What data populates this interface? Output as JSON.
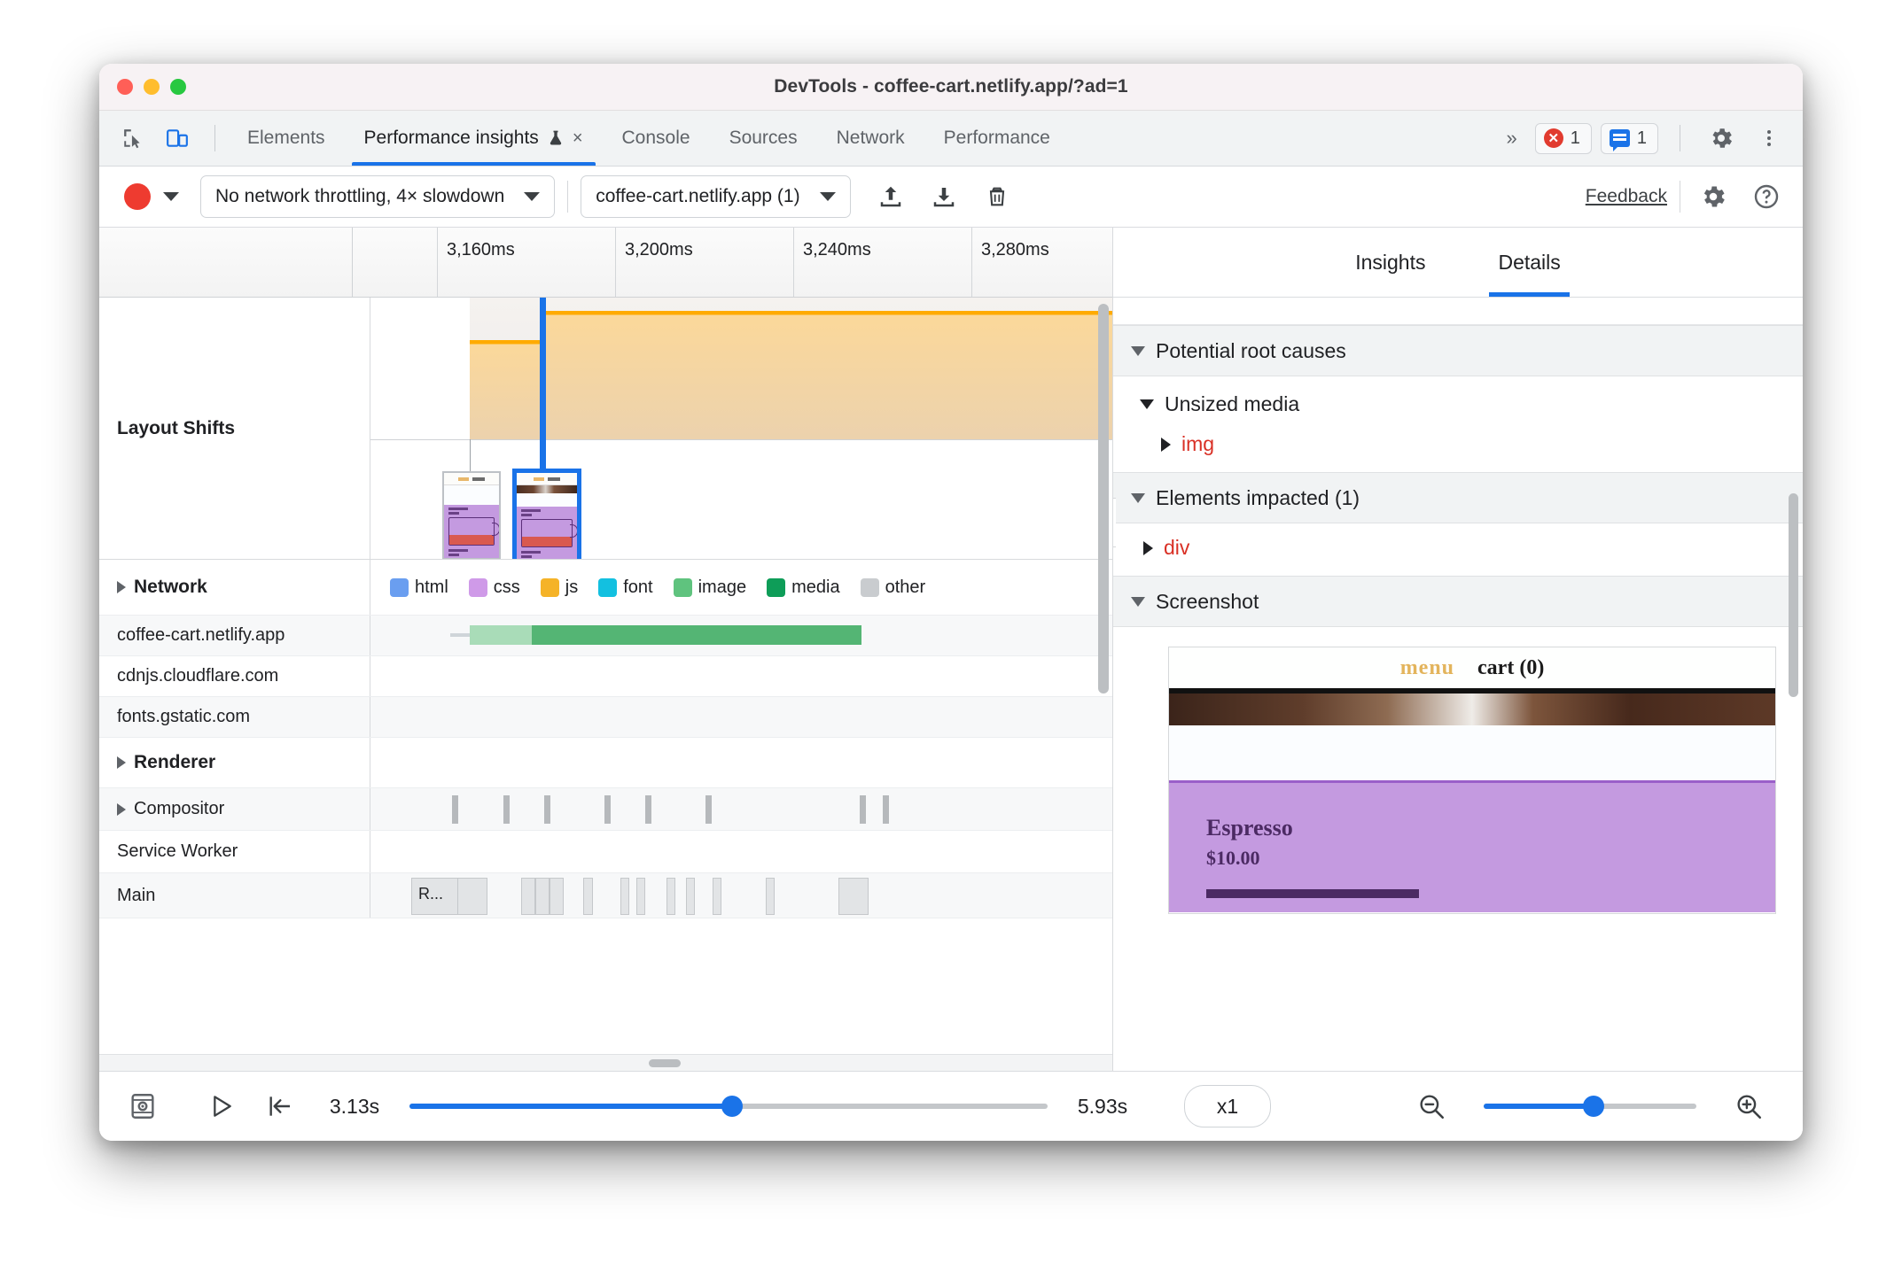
{
  "window": {
    "title": "DevTools - coffee-cart.netlify.app/?ad=1"
  },
  "tabbar": {
    "inspect_icon": "inspect-cursor-icon",
    "device_icon": "device-toolbar-icon",
    "tabs": [
      {
        "label": "Elements",
        "active": false
      },
      {
        "label": "Performance insights",
        "active": true,
        "beaker": "⚗",
        "close": "×"
      },
      {
        "label": "Console",
        "active": false
      },
      {
        "label": "Sources",
        "active": false
      },
      {
        "label": "Network",
        "active": false
      },
      {
        "label": "Performance",
        "active": false
      }
    ],
    "overflow": "»",
    "error_count": "1",
    "info_count": "1",
    "settings_icon": "gear-icon",
    "more_icon": "kebab-menu-icon"
  },
  "toolbar": {
    "record_icon": "record-button",
    "record_caret": "chevron-down-icon",
    "throttling": "No network throttling, 4× slowdown",
    "page_select": "coffee-cart.netlify.app (1)",
    "upload_icon": "upload-icon",
    "download_icon": "download-icon",
    "trash_icon": "trash-icon",
    "feedback": "Feedback",
    "settings_icon": "gear-icon",
    "help_icon": "help-icon"
  },
  "timeline": {
    "ticks": [
      "3,160ms",
      "3,200ms",
      "3,240ms",
      "3,280ms"
    ],
    "tracks": {
      "layout_shifts": "Layout Shifts",
      "network": "Network",
      "renderer": "Renderer",
      "compositor": "Compositor",
      "service_worker": "Service Worker",
      "main": "Main",
      "main_task_label": "R..."
    },
    "network_legend": [
      {
        "label": "html",
        "color": "#6a9ef0"
      },
      {
        "label": "css",
        "color": "#cf9ae8"
      },
      {
        "label": "js",
        "color": "#f5b328"
      },
      {
        "label": "font",
        "color": "#13c0e0"
      },
      {
        "label": "image",
        "color": "#5fc37e"
      },
      {
        "label": "media",
        "color": "#0e9d58"
      },
      {
        "label": "other",
        "color": "#c9cccf"
      }
    ],
    "network_rows": [
      "coffee-cart.netlify.app",
      "cdnjs.cloudflare.com",
      "fonts.gstatic.com"
    ]
  },
  "details_panel": {
    "tabs": [
      {
        "label": "Insights",
        "active": false
      },
      {
        "label": "Details",
        "active": true
      }
    ],
    "sections": [
      {
        "title": "Potential root causes",
        "expanded": true
      },
      {
        "title": "Elements impacted (1)",
        "expanded": true
      },
      {
        "title": "Screenshot",
        "expanded": true
      }
    ],
    "root_cause_group": "Unsized media",
    "root_cause_node": "img",
    "impacted_node": "div",
    "collapse_icon": "›",
    "screenshot": {
      "nav_menu": "menu",
      "nav_cart": "cart (0)",
      "product_title": "Espresso",
      "product_price": "$10.00"
    }
  },
  "bottombar": {
    "filmstrip_icon": "filmstrip-icon",
    "play_icon": "play-button",
    "jump_start_icon": "jump-to-start-icon",
    "start_time": "3.13s",
    "end_time": "5.93s",
    "speed": "x1",
    "zoom_out_icon": "zoom-out-icon",
    "zoom_in_icon": "zoom-in-icon"
  },
  "colors": {
    "accent": "#1a73e8",
    "error": "#d93025",
    "shift_orange": "#ffab00",
    "record_red": "#ee3b30"
  }
}
